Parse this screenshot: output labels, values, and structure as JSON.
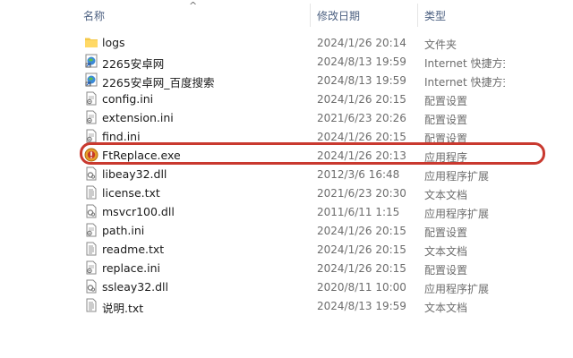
{
  "header": {
    "name_label": "名称",
    "date_label": "修改日期",
    "type_label": "类型",
    "sort_indicator": "^"
  },
  "highlight_color": "#c9392f",
  "files": [
    {
      "name": "logs",
      "date": "2024/1/26 20:14",
      "type": "文件夹",
      "icon": "folder-icon"
    },
    {
      "name": "2265安卓网",
      "date": "2024/8/13 19:59",
      "type": "Internet 快捷方式",
      "icon": "internet-shortcut-icon"
    },
    {
      "name": "2265安卓网_百度搜索",
      "date": "2024/8/13 19:59",
      "type": "Internet 快捷方式",
      "icon": "internet-shortcut-icon"
    },
    {
      "name": "config.ini",
      "date": "2024/1/26 20:15",
      "type": "配置设置",
      "icon": "ini-file-icon"
    },
    {
      "name": "extension.ini",
      "date": "2021/6/23 20:26",
      "type": "配置设置",
      "icon": "ini-file-icon"
    },
    {
      "name": "find.ini",
      "date": "2024/1/26 20:15",
      "type": "配置设置",
      "icon": "ini-file-icon"
    },
    {
      "name": "FtReplace.exe",
      "date": "2024/1/26 20:13",
      "type": "应用程序",
      "icon": "exe-app-icon"
    },
    {
      "name": "libeay32.dll",
      "date": "2012/3/6 16:48",
      "type": "应用程序扩展",
      "icon": "dll-file-icon"
    },
    {
      "name": "license.txt",
      "date": "2021/6/23 20:30",
      "type": "文本文档",
      "icon": "text-file-icon"
    },
    {
      "name": "msvcr100.dll",
      "date": "2011/6/11 1:15",
      "type": "应用程序扩展",
      "icon": "dll-file-icon"
    },
    {
      "name": "path.ini",
      "date": "2024/1/26 20:15",
      "type": "配置设置",
      "icon": "ini-file-icon"
    },
    {
      "name": "readme.txt",
      "date": "2024/1/26 20:15",
      "type": "文本文档",
      "icon": "text-file-icon"
    },
    {
      "name": "replace.ini",
      "date": "2024/1/26 20:15",
      "type": "配置设置",
      "icon": "ini-file-icon"
    },
    {
      "name": "ssleay32.dll",
      "date": "2020/8/11 10:00",
      "type": "应用程序扩展",
      "icon": "dll-file-icon"
    },
    {
      "name": "说明.txt",
      "date": "2024/8/13 19:59",
      "type": "文本文档",
      "icon": "text-file-icon"
    }
  ]
}
